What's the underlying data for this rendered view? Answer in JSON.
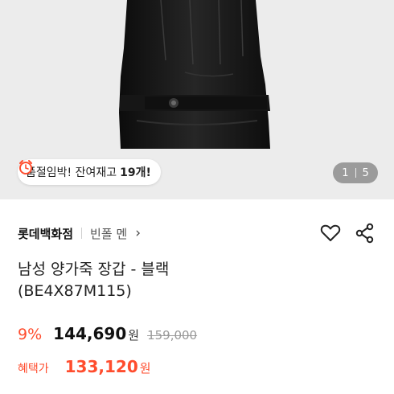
{
  "product_image": {
    "description_icon": "glove-photo",
    "stock_badge": {
      "icon": "alarm-clock-icon",
      "text": "품절임박! 잔여재고",
      "count": "19개!"
    },
    "pager": {
      "current": "1",
      "total": "5"
    }
  },
  "store": {
    "name": "롯데백화점",
    "brand": "빈폴 멘",
    "arrow": "›"
  },
  "actions": {
    "wishlist_icon": "heart-icon",
    "share_icon": "share-icon"
  },
  "product": {
    "title_line1": "남성 양가죽 장갑 - 블랙",
    "title_line2": "(BE4X87M115)"
  },
  "pricing": {
    "discount": "9%",
    "price": "144,690",
    "currency": "원",
    "original": "159,000",
    "benefit_label": "혜택가",
    "benefit_price": "133,120",
    "benefit_currency": "원"
  },
  "colors": {
    "accent": "#ff4d2e",
    "image_bg": "#ececec"
  }
}
